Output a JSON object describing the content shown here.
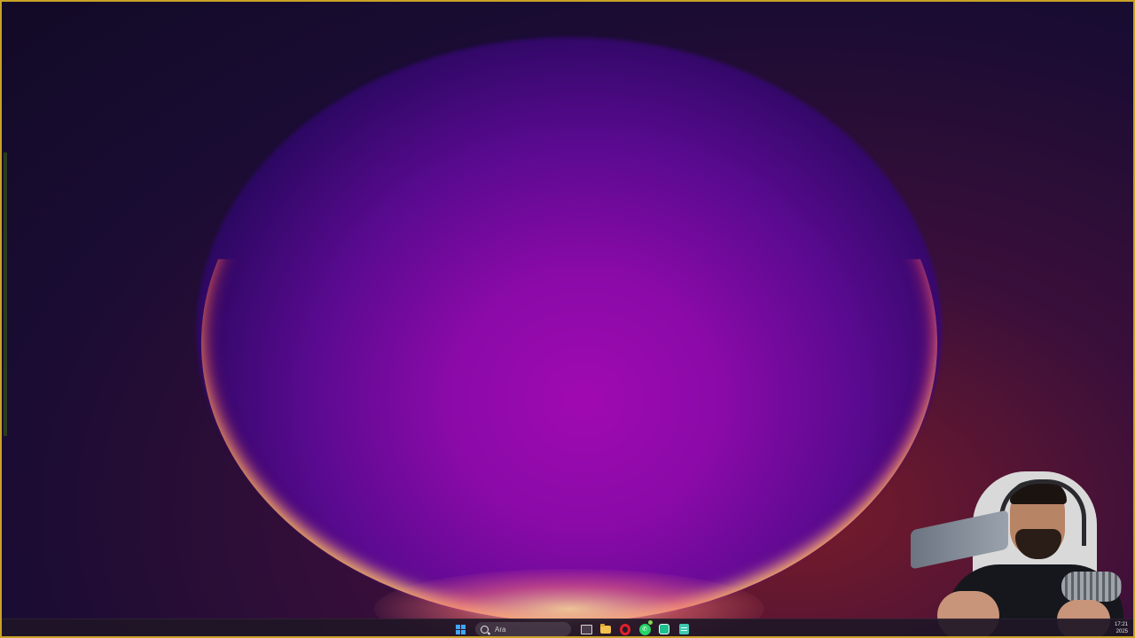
{
  "desktop": {
    "wallpaper_icon": "windows-bloom-wallpaper",
    "frame_color": "#c9a227"
  },
  "taskbar": {
    "search_placeholder": "Ara",
    "apps": [
      {
        "name": "start",
        "icon": "windows-logo-icon"
      },
      {
        "name": "task-view",
        "icon": "task-view-icon"
      },
      {
        "name": "file-explorer",
        "icon": "folder-icon"
      },
      {
        "name": "opera",
        "icon": "opera-browser-icon"
      },
      {
        "name": "whatsapp",
        "icon": "whatsapp-icon"
      },
      {
        "name": "green-app",
        "icon": "app-icon"
      },
      {
        "name": "notepad",
        "icon": "notepad-icon"
      }
    ],
    "clock": {
      "time": "17:21",
      "date": "2025"
    }
  },
  "webcam": {
    "icon": "webcam-overlay"
  },
  "colors": {
    "accent": "#3ea6ff",
    "taskbar_bg": "#201626",
    "whatsapp": "#25d366",
    "opera": "#e0202a"
  }
}
